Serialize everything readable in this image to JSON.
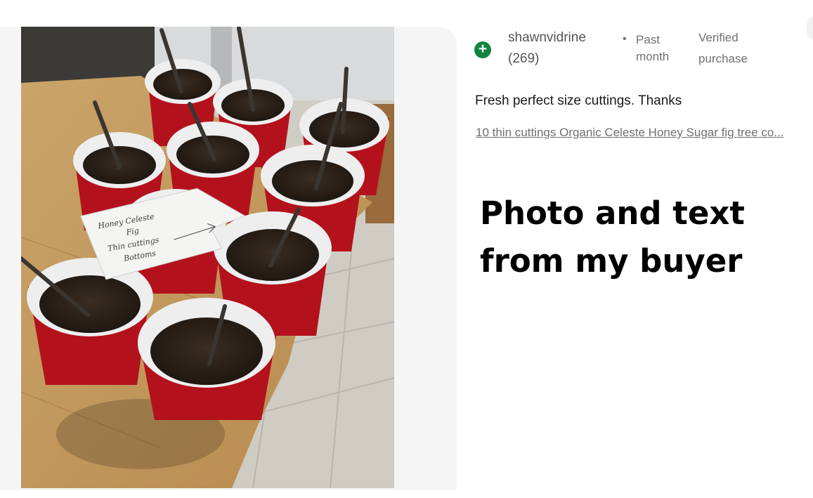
{
  "review": {
    "avatar_icon": "plus-circle-icon",
    "avatar_color": "#128440",
    "user_name": "shawnvidrine",
    "user_feedback_count": "(269)",
    "separator": "•",
    "time_line1": "Past",
    "time_line2": "month",
    "verified_line1": "Verified",
    "verified_line2": "purchase",
    "text": "Fresh perfect size cuttings. Thanks",
    "item_link": "10 thin cuttings Organic Celeste Honey Sugar fig tree co..."
  },
  "photo": {
    "note_lines": [
      "Honey Celeste",
      "Fig",
      "Thin cuttings",
      "Bottoms"
    ]
  },
  "annotation": {
    "line1": "Photo and text",
    "line2": "from my buyer"
  }
}
